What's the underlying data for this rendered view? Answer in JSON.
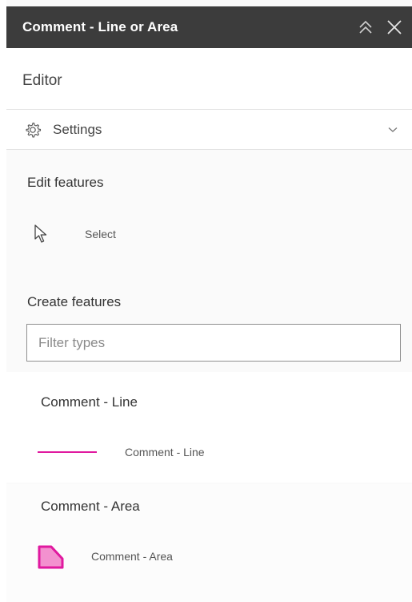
{
  "window": {
    "title": "Comment - Line or Area",
    "collapse_icon": "double-chevron-up-icon",
    "close_icon": "close-icon"
  },
  "editor": {
    "title": "Editor"
  },
  "settings": {
    "label": "Settings",
    "icon": "gear-icon",
    "expand_icon": "chevron-down-icon"
  },
  "edit_features": {
    "title": "Edit features",
    "tools": [
      {
        "label": "Select",
        "icon": "cursor-icon"
      }
    ]
  },
  "create_features": {
    "title": "Create features",
    "filter": {
      "placeholder": "Filter types",
      "value": ""
    },
    "groups": [
      {
        "title": "Comment - Line",
        "items": [
          {
            "label": "Comment - Line",
            "symbol": "line-symbol",
            "color": "#e0199f"
          }
        ]
      },
      {
        "title": "Comment - Area",
        "items": [
          {
            "label": "Comment - Area",
            "symbol": "polygon-symbol",
            "color": "#e0199f"
          }
        ]
      }
    ]
  },
  "colors": {
    "titlebar": "#3c3c3c",
    "accent": "#e0199f"
  }
}
